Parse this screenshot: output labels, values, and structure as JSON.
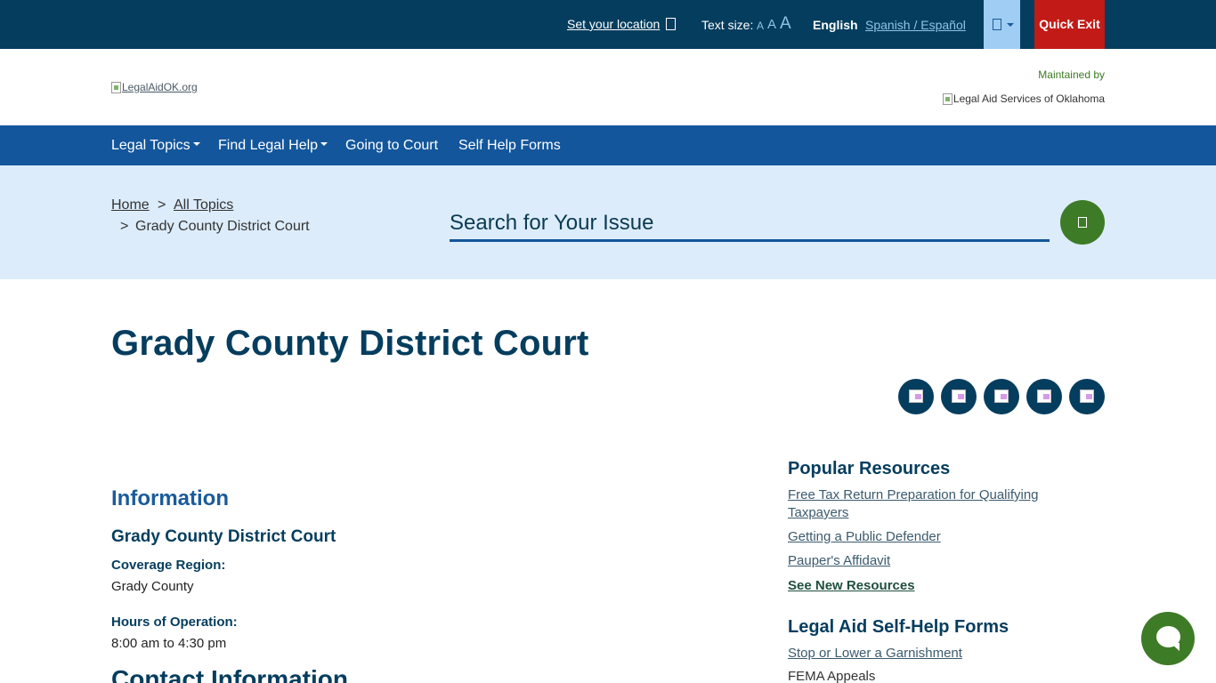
{
  "topbar": {
    "set_location": "Set your location",
    "text_size_label": "Text size:",
    "text_size_small": "A",
    "text_size_medium": "A",
    "text_size_large": "A",
    "lang_english": "English",
    "lang_spanish": "Spanish / Español",
    "quick_exit": "Quick Exit"
  },
  "header": {
    "logo_alt": "LegalAidOK.org",
    "maintained_by": "Maintained by",
    "partner_logo_alt": "Legal Aid Services of Oklahoma"
  },
  "nav": {
    "items": [
      {
        "label": "Legal Topics"
      },
      {
        "label": "Find Legal Help"
      },
      {
        "label": "Going to Court"
      },
      {
        "label": "Self Help Forms"
      }
    ]
  },
  "breadcrumb": {
    "home": "Home",
    "sep1": ">",
    "all_topics": "All Topics",
    "sep2": ">",
    "current": "Grady County District Court"
  },
  "search": {
    "placeholder": "Search for Your Issue"
  },
  "main": {
    "title": "Grady County District Court",
    "info_heading": "Information",
    "court_name": "Grady County District Court",
    "coverage_label": "Coverage Region:",
    "coverage_value": "Grady County",
    "hours_label": "Hours of Operation:",
    "hours_value": "8:00 am to 4:30 pm",
    "contact_heading": "Contact Information"
  },
  "sidebar": {
    "popular_heading": "Popular Resources",
    "popular_links": [
      "Free Tax Return Preparation for Qualifying Taxpayers",
      "Getting a Public Defender",
      "Pauper's Affidavit"
    ],
    "see_new": "See New Resources",
    "forms_heading": "Legal Aid Self-Help Forms",
    "form_links": [
      "Stop or Lower a Garnishment",
      "FEMA Appeals"
    ]
  },
  "colors": {
    "topbar_bg": "#053d5e",
    "nav_bg": "#13569b",
    "band_bg": "#dcecfb",
    "quick_exit_bg": "#c21b17",
    "accent_green": "#3e7b27"
  },
  "icons": {
    "location": "location-icon",
    "accessibility": "accessibility-icon",
    "search": "search-icon",
    "share": [
      "share-icon-1",
      "share-icon-2",
      "share-icon-3",
      "share-icon-4",
      "share-icon-5"
    ],
    "chat": "chat-icon"
  }
}
